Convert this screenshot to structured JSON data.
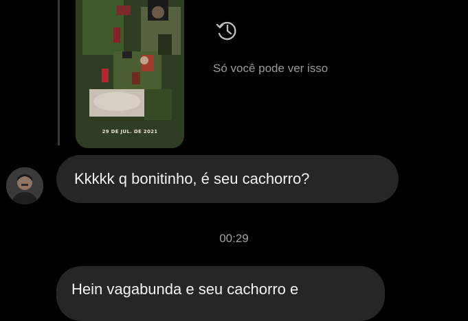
{
  "story_reply": {
    "date_label": "29 DE JUL. DE 2021",
    "expired_icon": "history-icon",
    "expired_text": "Só você pode ver isso"
  },
  "messages": [
    {
      "sender": "other",
      "avatar_icon": "user-avatar",
      "text": "Kkkkk q bonitinho, é seu cachorro?"
    },
    {
      "sender": "other",
      "text": "Hein vagabunda e seu cachorro e"
    }
  ],
  "timestamp": "00:29",
  "colors": {
    "background": "#000000",
    "bubble": "#262626",
    "secondary_text": "#9a9a9a"
  }
}
